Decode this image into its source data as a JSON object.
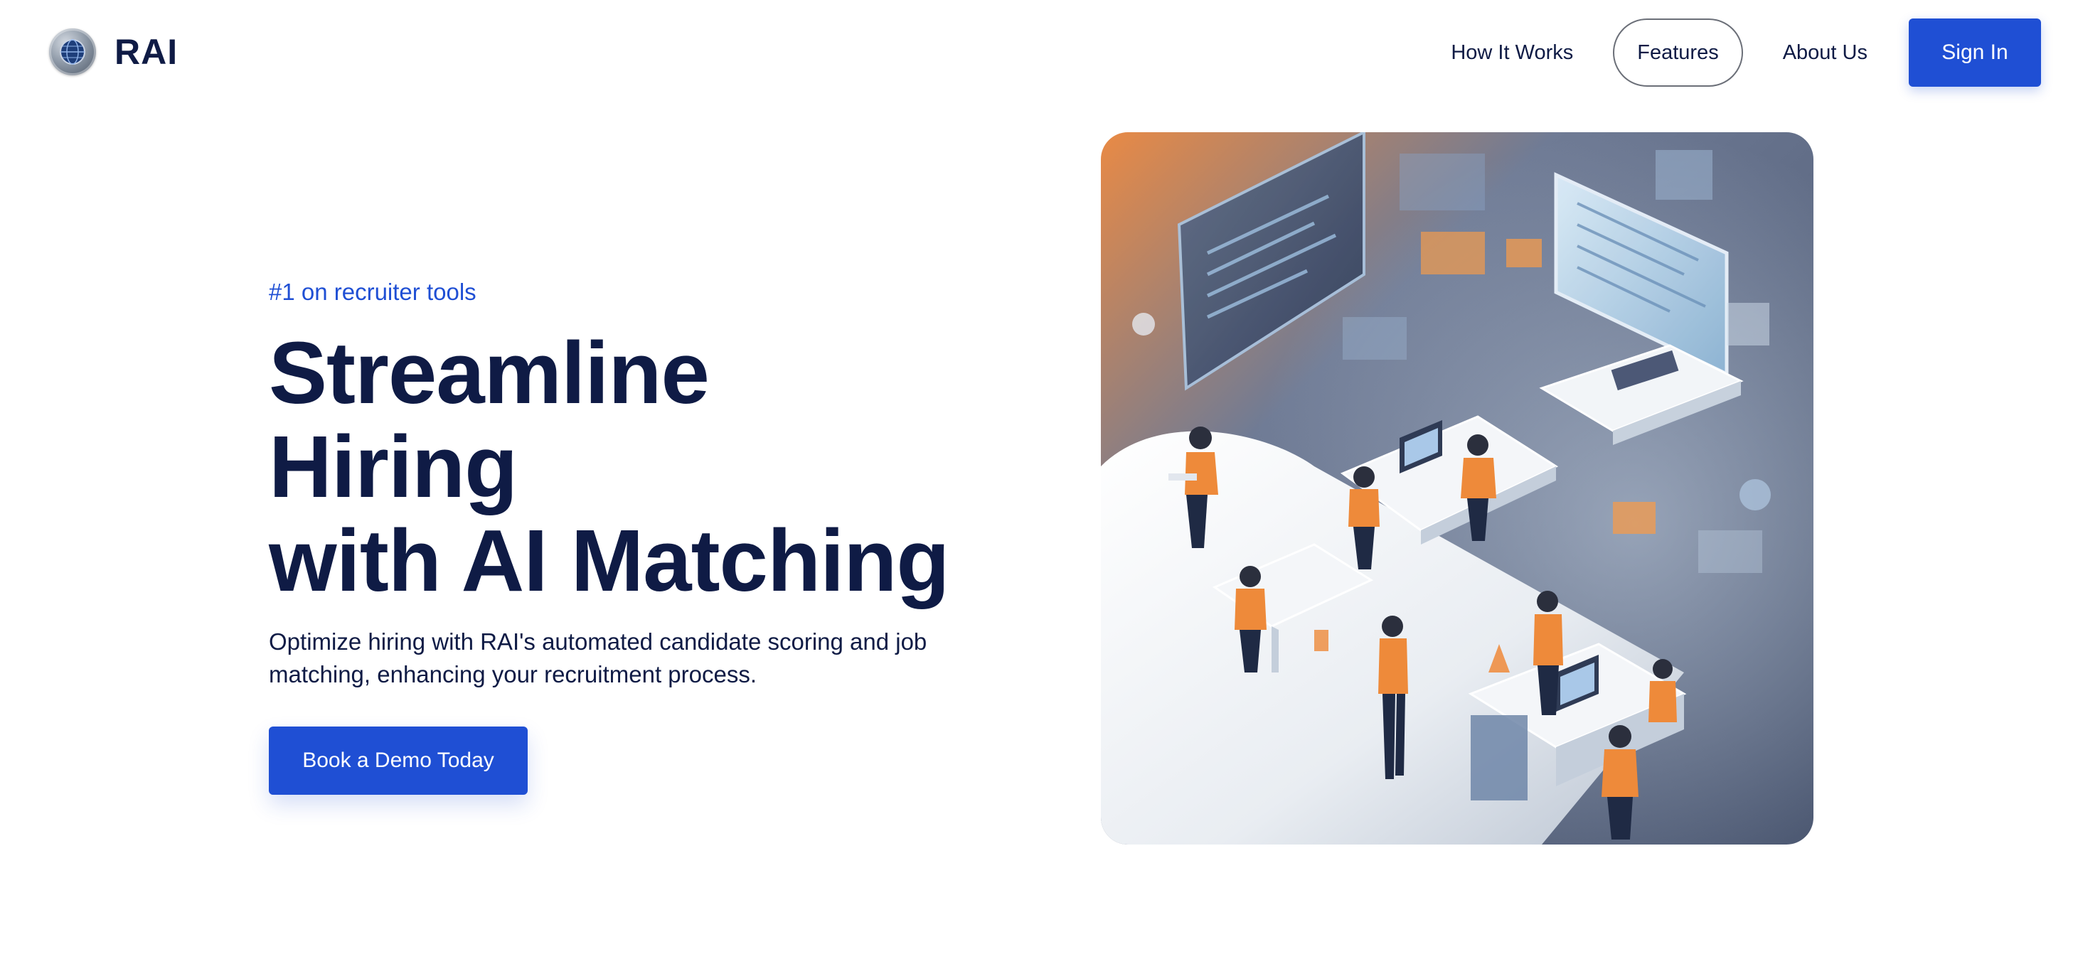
{
  "header": {
    "brand": "RAI",
    "logo_icon": "rai-globe-logo-icon",
    "nav": [
      {
        "label": "How It Works",
        "active": false
      },
      {
        "label": "Features",
        "active": true
      },
      {
        "label": "About Us",
        "active": false
      }
    ],
    "signin_label": "Sign In"
  },
  "hero": {
    "eyebrow": "#1 on recruiter tools",
    "headline_line1": "Streamline Hiring",
    "headline_line2": "with AI Matching",
    "subhead": "Optimize hiring with RAI's automated candidate scoring and job matching, enhancing your recruitment process.",
    "cta_label": "Book a Demo Today",
    "illustration": "isometric-office-team-illustration"
  },
  "colors": {
    "brand_blue": "#1f4fd4",
    "navy_text": "#0f1b45",
    "accent_orange": "#ee8a3a",
    "slate": "#5b6a86"
  }
}
